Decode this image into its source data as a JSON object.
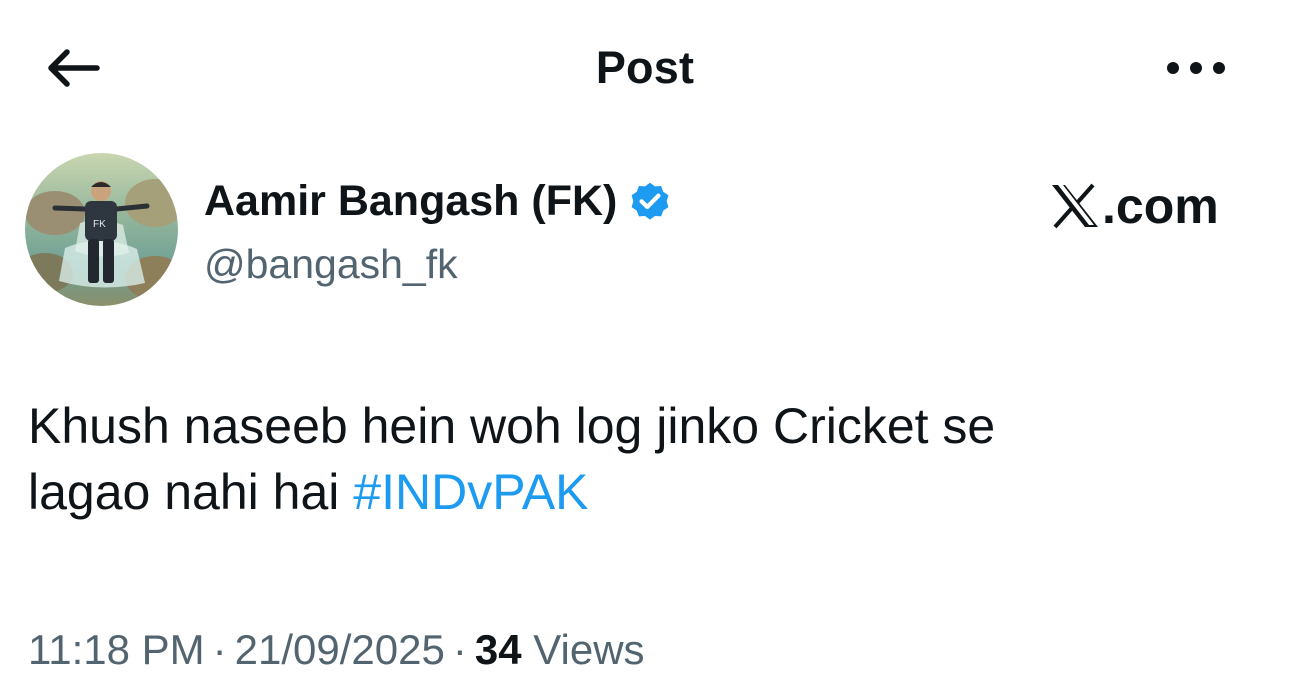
{
  "header": {
    "title": "Post",
    "back_icon": "arrow-left-icon",
    "more_icon": "more-horizontal-icon"
  },
  "author": {
    "display_name": "Aamir Bangash (FK)",
    "handle": "@bangash_fk",
    "verified": true,
    "avatar_text": "FK"
  },
  "watermark": {
    "logo_text": "X",
    "text": ".com"
  },
  "post": {
    "line1": "Khush naseeb hein woh log jinko Cricket se",
    "line2_text": "lagao nahi hai ",
    "hashtag": "#INDvPAK"
  },
  "meta": {
    "time": "11:18 PM",
    "separator": "·",
    "date": "21/09/2025",
    "views_count": "34",
    "views_label": "Views"
  },
  "colors": {
    "text_primary": "#0f1419",
    "text_secondary": "#536471",
    "accent": "#1d9bf0",
    "background": "#ffffff"
  }
}
